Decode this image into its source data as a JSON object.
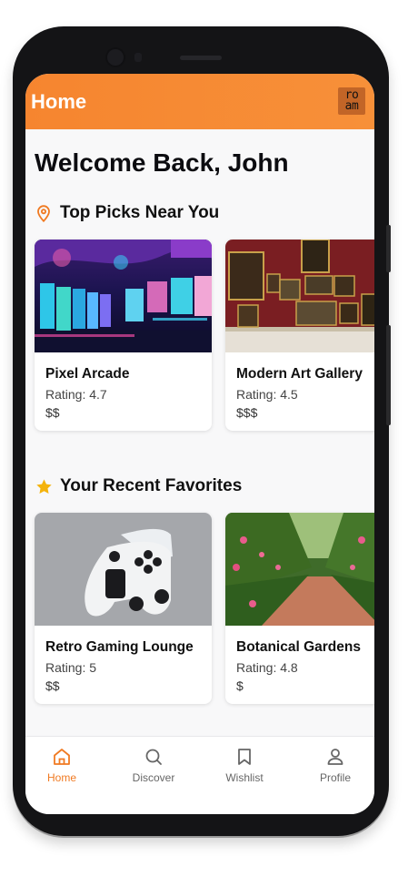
{
  "header": {
    "title": "Home",
    "logo_text": "ro\nam",
    "brand_color": "#f6852f"
  },
  "welcome": "Welcome Back, John",
  "sections": [
    {
      "title": "Top Picks Near You",
      "icon": "map-pin-icon",
      "cards": [
        {
          "name": "Pixel Arcade",
          "rating": "Rating: 4.7",
          "price": "$$",
          "image": "arcade-photo"
        },
        {
          "name": "Modern Art Gallery",
          "rating": "Rating: 4.5",
          "price": "$$$",
          "image": "gallery-photo"
        }
      ]
    },
    {
      "title": "Your Recent Favorites",
      "icon": "star-icon",
      "cards": [
        {
          "name": "Retro Gaming Lounge",
          "rating": "Rating: 5",
          "price": "$$",
          "image": "game-controller-photo"
        },
        {
          "name": "Botanical Gardens",
          "rating": "Rating: 4.8",
          "price": "$",
          "image": "garden-photo"
        }
      ]
    }
  ],
  "nav": [
    {
      "label": "Home",
      "icon": "home-icon",
      "active": true
    },
    {
      "label": "Discover",
      "icon": "search-icon",
      "active": false
    },
    {
      "label": "Wishlist",
      "icon": "bookmark-icon",
      "active": false
    },
    {
      "label": "Profile",
      "icon": "user-icon",
      "active": false
    }
  ]
}
